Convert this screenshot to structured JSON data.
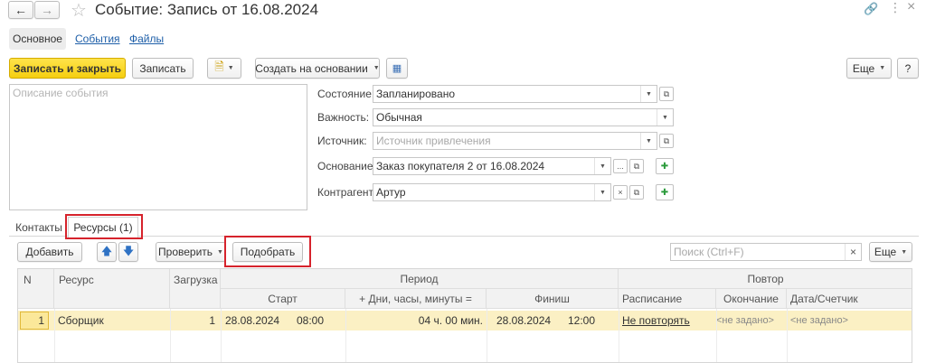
{
  "window": {
    "title": "Событие: Запись от 16.08.2024"
  },
  "tabs_top": {
    "main": "Основное",
    "events": "События",
    "files": "Файлы"
  },
  "toolbar": {
    "save_close": "Записать и закрыть",
    "save": "Записать",
    "create_based": "Создать на основании",
    "more": "Еще",
    "help": "?"
  },
  "description": {
    "placeholder": "Описание события"
  },
  "fields": {
    "state_label": "Состояние:",
    "state_value": "Запланировано",
    "importance_label": "Важность:",
    "importance_value": "Обычная",
    "source_label": "Источник:",
    "source_placeholder": "Источник привлечения",
    "basis_label": "Основание:",
    "basis_value": "Заказ покупателя 2 от 16.08.2024",
    "contractor_label": "Контрагент:",
    "contractor_value": "Артур",
    "ellipsis": "...",
    "clear": "×"
  },
  "tabs_bottom": {
    "contacts": "Контакты",
    "resources": "Ресурсы (1)"
  },
  "table_toolbar": {
    "add": "Добавить",
    "check": "Проверить",
    "pick": "Подобрать",
    "search_placeholder": "Поиск (Ctrl+F)",
    "more": "Еще"
  },
  "table": {
    "headers": {
      "n": "N",
      "resource": "Ресурс",
      "load": "Загрузка",
      "period": "Период",
      "repeat": "Повтор",
      "start": "Старт",
      "days": "+ Дни, часы, минуты =",
      "finish": "Финиш",
      "schedule": "Расписание",
      "end": "Окончание",
      "date_counter": "Дата/Счетчик"
    },
    "rows": [
      {
        "n": "1",
        "resource": "Сборщик",
        "load": "1",
        "start_date": "28.08.2024",
        "start_time": "08:00",
        "duration": "04 ч. 00 мин.",
        "finish_date": "28.08.2024",
        "finish_time": "12:00",
        "schedule": "Не повторять",
        "end": "<не задано>",
        "date_counter": "<не задано>"
      }
    ]
  },
  "colors": {
    "primary": "#f5cf10",
    "selected_row": "#fbf0c4",
    "link": "#1d5ea8",
    "highlight": "#d6232c"
  }
}
